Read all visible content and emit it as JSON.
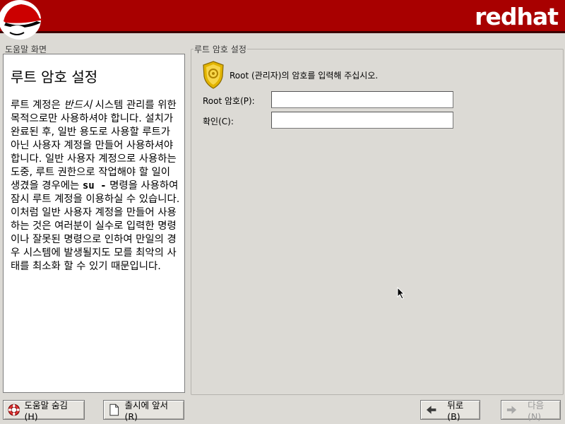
{
  "header": {
    "brand": "redhat"
  },
  "help_panel": {
    "frame_label": "도움말 화면",
    "title": "루트 암호 설정",
    "text_part1": "루트 계정은 ",
    "text_em": "반드시",
    "text_part2": " 시스템 관리를 위한 목적으로만 사용하셔야 합니다. 설치가 완료된 후, 일반 용도로 사용할 루트가 아닌 사용자 계정을 만들어 사용하셔야 합니다. 일반 사용자 계정으로 사용하는 도중, 루트 권한으로 작업해야 할 일이 생겼을 경우에는 ",
    "text_code": "su -",
    "text_part3": " 명령을 사용하여 잠시 루트 계정을 이용하실 수 있습니다. 이처럼 일반 사용자 계정을 만들어 사용하는 것은 여러분이 실수로 입력한 명령이나 잘못된 명령으로 인하여 만일의 경우 시스템에 발생될지도 모를 최악의 사태를 최소화 할 수 있기 때문입니다."
  },
  "main": {
    "frame_label": "루트 암호 설정",
    "intro": "Root (관리자)의 암호를 입력해 주십시오.",
    "password_label": "Root 암호(P):",
    "password_value": "",
    "confirm_label": "확인(C):",
    "confirm_value": ""
  },
  "buttons": {
    "hide_help": "도움말 숨김(H)",
    "release_notes": "출시에 앞서(R)",
    "back": "뒤로(B)",
    "next": "다음(N)"
  },
  "icons": {
    "header_logo": "shadowman-logo",
    "shield": "shield-key-icon",
    "lifebuoy": "lifebuoy-icon",
    "document": "document-icon",
    "back_arrow": "arrow-left-icon",
    "next_arrow": "arrow-right-icon"
  },
  "colors": {
    "header_bg": "#a80000",
    "window_bg": "#dcdad5"
  }
}
